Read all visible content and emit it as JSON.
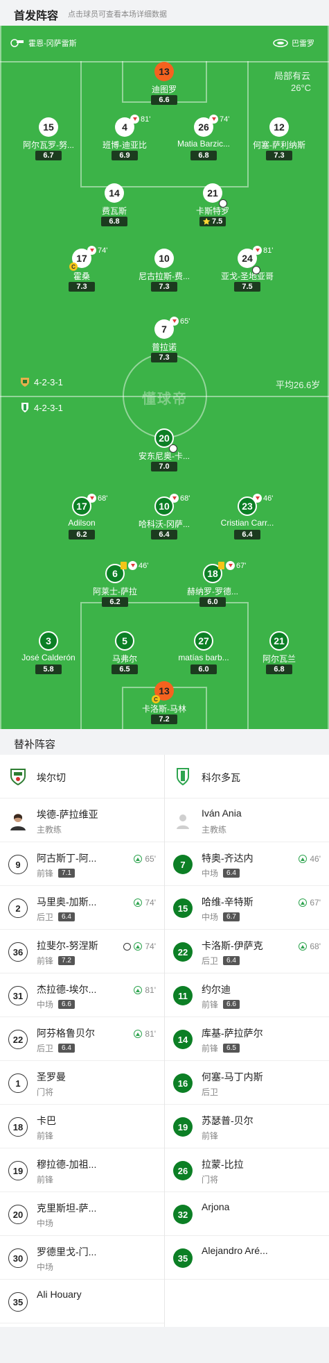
{
  "header": {
    "title": "首发阵容",
    "subtitle": "点击球员可查看本场详细数据"
  },
  "pitch": {
    "home_team": "霍恩-冈萨雷斯",
    "away_team": "巴雷罗",
    "corner_text": "局部有云",
    "temperature": "26°C",
    "home_formation": "4-2-3-1",
    "away_formation": "4-2-3-1",
    "avg_age": "平均26.6岁",
    "watermark": "懂球帝"
  },
  "top_players": [
    {
      "num": "13",
      "name": "迪图罗",
      "rating": "6.6",
      "gk": true
    },
    {
      "num": "15",
      "name": "阿尔瓦罗-努...",
      "rating": "6.7"
    },
    {
      "num": "4",
      "name": "班博-迪亚比",
      "rating": "6.9",
      "sub": "81'"
    },
    {
      "num": "26",
      "name": "Matia Barzic...",
      "rating": "6.8",
      "sub": "74'"
    },
    {
      "num": "12",
      "name": "何塞-萨利纳斯",
      "rating": "7.3"
    },
    {
      "num": "14",
      "name": "费瓦斯",
      "rating": "6.8"
    },
    {
      "num": "21",
      "name": "卡斯特罗",
      "rating": "7.5",
      "star": "⭐"
    },
    {
      "num": "17",
      "name": "霍桑",
      "rating": "7.3",
      "sub": "74'",
      "captain": "C"
    },
    {
      "num": "10",
      "name": "尼古拉斯-费...",
      "rating": "7.3"
    },
    {
      "num": "24",
      "name": "亚戈-圣地亚哥",
      "rating": "7.5",
      "sub": "81'"
    },
    {
      "num": "7",
      "name": "普拉诺",
      "rating": "7.3",
      "sub": "65'"
    }
  ],
  "bottom_players": [
    {
      "num": "20",
      "name": "安东尼奥-卡...",
      "rating": "7.0"
    },
    {
      "num": "17",
      "name": "Adilson",
      "rating": "6.2",
      "sub": "68'"
    },
    {
      "num": "10",
      "name": "哈科沃-冈萨...",
      "rating": "6.4",
      "sub": "68'"
    },
    {
      "num": "23",
      "name": "Cristian Carr...",
      "rating": "6.4",
      "sub": "46'"
    },
    {
      "num": "6",
      "name": "阿莱士-萨拉",
      "rating": "6.2",
      "sub": "46'"
    },
    {
      "num": "18",
      "name": "赫纳罗-罗德...",
      "rating": "6.0",
      "sub": "67'"
    },
    {
      "num": "3",
      "name": "José Calderón",
      "rating": "5.8"
    },
    {
      "num": "5",
      "name": "马弗尔",
      "rating": "6.5"
    },
    {
      "num": "27",
      "name": "matías barb...",
      "rating": "6.0"
    },
    {
      "num": "21",
      "name": "阿尔瓦兰",
      "rating": "6.8"
    },
    {
      "num": "13",
      "name": "卡洛斯-马林",
      "rating": "7.2",
      "gk": true,
      "captain": "C"
    }
  ],
  "subs": {
    "title": "替补阵容",
    "left_team": "埃尔切",
    "right_team": "科尔多瓦",
    "left_coach": {
      "name": "埃德-萨拉维亚",
      "role": "主教练"
    },
    "right_coach": {
      "name": "Iván Ania",
      "role": "主教练"
    },
    "left": [
      {
        "num": "9",
        "name": "阿古斯丁-阿...",
        "pos": "前锋",
        "rating": "7.1",
        "minute": "65'"
      },
      {
        "num": "2",
        "name": "马里奥-加斯...",
        "pos": "后卫",
        "rating": "6.4",
        "minute": "74'"
      },
      {
        "num": "36",
        "name": "拉斐尔-努涅斯",
        "pos": "前锋",
        "rating": "7.2",
        "minute": "74'",
        "goal": true
      },
      {
        "num": "31",
        "name": "杰拉德-埃尔...",
        "pos": "中场",
        "rating": "6.6",
        "minute": "81'"
      },
      {
        "num": "22",
        "name": "阿芬格鲁贝尔",
        "pos": "后卫",
        "rating": "6.4",
        "minute": "81'"
      },
      {
        "num": "1",
        "name": "圣罗曼",
        "pos": "门将"
      },
      {
        "num": "18",
        "name": "卡巴",
        "pos": "前锋"
      },
      {
        "num": "19",
        "name": "穆拉德-加祖...",
        "pos": "前锋"
      },
      {
        "num": "20",
        "name": "克里斯坦-萨...",
        "pos": "中场"
      },
      {
        "num": "30",
        "name": "罗德里戈-门...",
        "pos": "中场"
      },
      {
        "num": "35",
        "name": "Ali Houary",
        "pos": ""
      }
    ],
    "right": [
      {
        "num": "7",
        "name": "特奥-齐达内",
        "pos": "中场",
        "rating": "6.4",
        "minute": "46'"
      },
      {
        "num": "15",
        "name": "哈维-辛特斯",
        "pos": "中场",
        "rating": "6.7",
        "minute": "67'"
      },
      {
        "num": "22",
        "name": "卡洛斯-伊萨克",
        "pos": "后卫",
        "rating": "6.4",
        "minute": "68'"
      },
      {
        "num": "11",
        "name": "约尔迪",
        "pos": "前锋",
        "rating": "6.6"
      },
      {
        "num": "14",
        "name": "库基-萨拉萨尔",
        "pos": "前锋",
        "rating": "6.5"
      },
      {
        "num": "16",
        "name": "何塞-马丁内斯",
        "pos": "后卫"
      },
      {
        "num": "19",
        "name": "苏瑟普-贝尔",
        "pos": "前锋"
      },
      {
        "num": "26",
        "name": "拉蒙-比拉",
        "pos": "门将"
      },
      {
        "num": "32",
        "name": "Arjona",
        "pos": ""
      },
      {
        "num": "35",
        "name": "Alejandro Aré...",
        "pos": ""
      }
    ]
  },
  "colors": {
    "pitch": "#3cb348",
    "home_circle": "#ffffff",
    "away_circle": "#0c7f25",
    "goalkeeper": "#f4621f"
  }
}
